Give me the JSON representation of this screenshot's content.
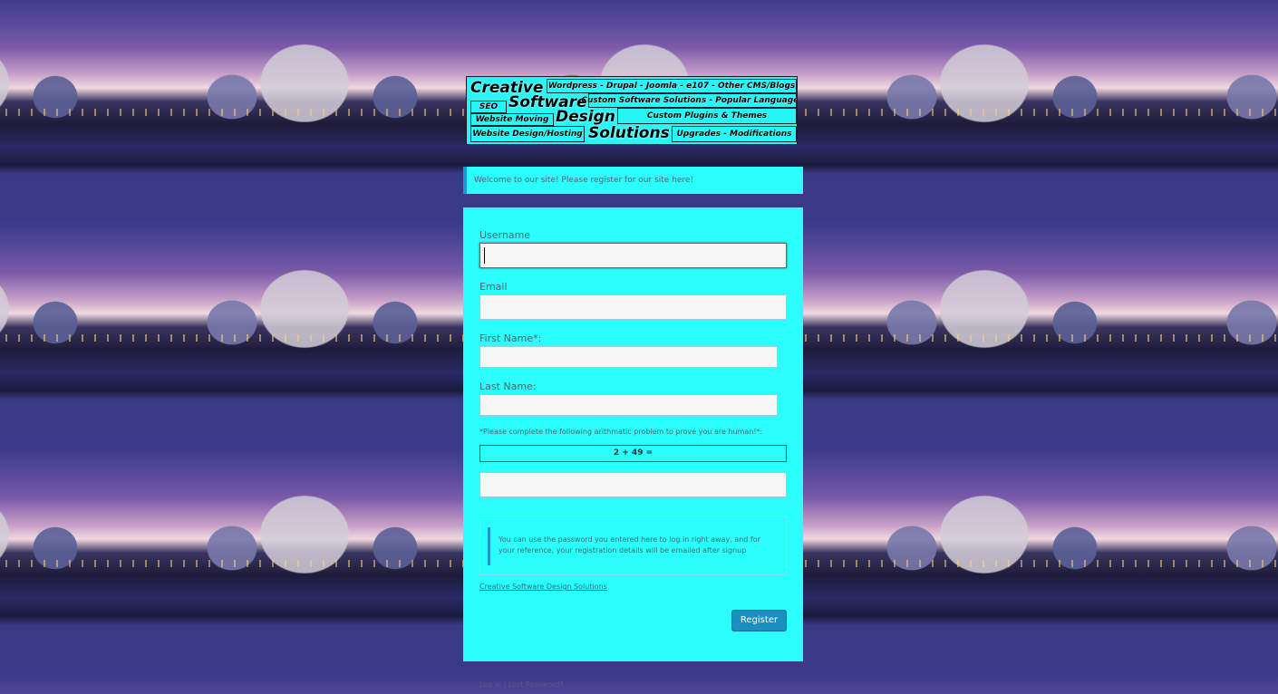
{
  "banner": {
    "title_word_1": "Creative",
    "title_word_2": "Software",
    "title_word_3": "Design",
    "title_word_4": "Solutions",
    "tag_cms": "Wordpress - Drupal - Joomla - e107 -  Other CMS/Blogs",
    "tag_custom_software": "Custom Software Solutions - Popular Languages",
    "tag_seo": "SEO",
    "tag_plugins": "Custom Plugins & Themes",
    "tag_moving": "Website Moving",
    "tag_hosting": "Website Design/Hosting",
    "tag_upgrades": "Upgrades - Modifications"
  },
  "welcome": {
    "message": "Welcome to our site! Please register for our site here!"
  },
  "form": {
    "username_label": "Username",
    "username_value": "",
    "email_label": "Email",
    "email_value": "",
    "first_name_label": "First Name*:",
    "first_name_value": "",
    "last_name_label": "Last Name:",
    "last_name_value": "",
    "captcha_note": "*Please complete the following arithmatic problem to prove you are human!*:",
    "captcha_problem": "2 + 49 =",
    "captcha_answer": "",
    "notice_text": "You can use the password you entered here to log in right away, and for your reference, your registration details will be emailed after signup",
    "site_link": "Creative Software Design Solutions",
    "register_button": "Register"
  },
  "footer": {
    "links_text": "Log in | Lost Password?"
  },
  "colors": {
    "panel_bg": "#2cfdfd",
    "accent_blue": "#1a9ad6",
    "button_bg": "#1a8fc2"
  }
}
